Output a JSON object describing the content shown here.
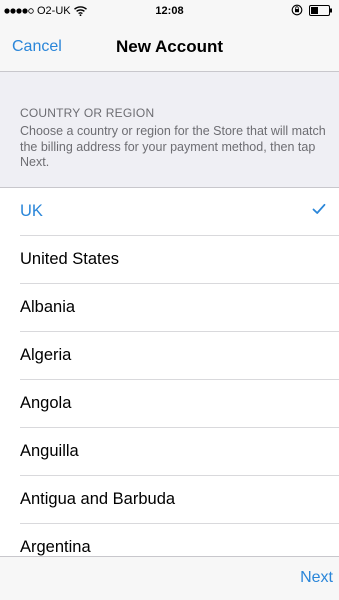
{
  "status_bar": {
    "carrier": "O2-UK",
    "time": "12:08",
    "signal_icon": "signal-dots-icon",
    "wifi_icon": "wifi-icon",
    "lock_icon": "rotation-lock-icon",
    "battery_icon": "battery-icon"
  },
  "nav": {
    "cancel_label": "Cancel",
    "title": "New Account"
  },
  "section": {
    "header": "COUNTRY OR REGION",
    "description": "Choose a country or region for the Store that will match the billing address for your payment method, then tap Next."
  },
  "countries": [
    {
      "label": "UK",
      "selected": true
    },
    {
      "label": "United States",
      "selected": false
    },
    {
      "label": "Albania",
      "selected": false
    },
    {
      "label": "Algeria",
      "selected": false
    },
    {
      "label": "Angola",
      "selected": false
    },
    {
      "label": "Anguilla",
      "selected": false
    },
    {
      "label": "Antigua and Barbuda",
      "selected": false
    },
    {
      "label": "Argentina",
      "selected": false
    }
  ],
  "toolbar": {
    "next_label": "Next"
  },
  "colors": {
    "accent": "#2a86d9",
    "grouped_background": "#efeff4",
    "bar_background": "#f7f7f7"
  }
}
